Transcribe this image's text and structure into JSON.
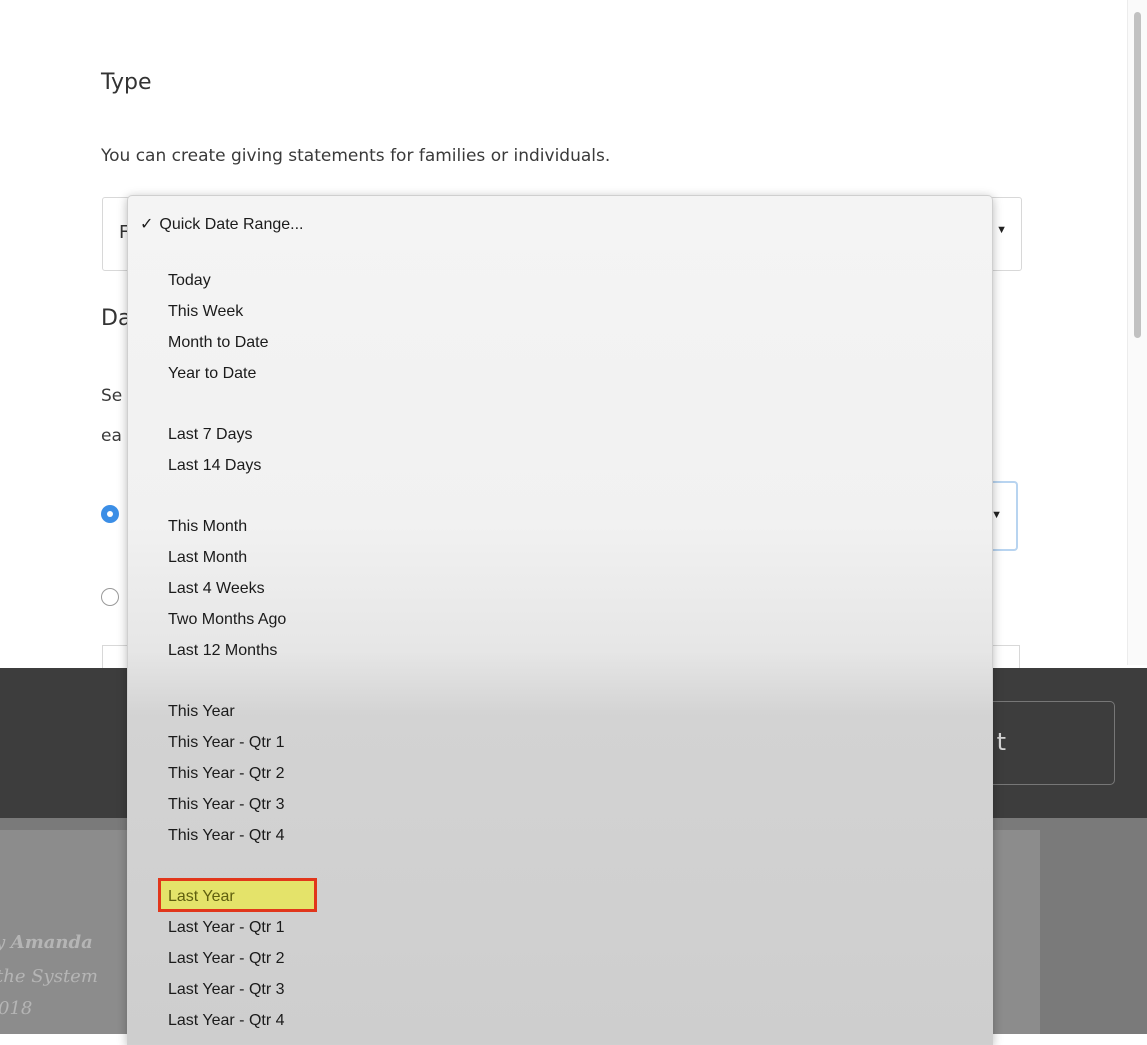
{
  "form": {
    "type_heading": "Type",
    "type_description": "You can create giving statements for families or individuals.",
    "type_select_partial": "F",
    "date_heading_partial": "Da",
    "date_desc_partial1": "Se",
    "date_desc_partial2": "ea"
  },
  "footer": {
    "button_partial": "t"
  },
  "footnotes": {
    "line1": "y Amanda",
    "line2": "the System",
    "line3": "018"
  },
  "dropdown": {
    "selected_label": "Quick Date Range...",
    "check_glyph": "✓",
    "highlighted_item": "Last Year",
    "groups": [
      [
        "Today",
        "This Week",
        "Month to Date",
        "Year to Date"
      ],
      [
        "Last 7 Days",
        "Last 14 Days"
      ],
      [
        "This Month",
        "Last Month",
        "Last 4 Weeks",
        "Two Months Ago",
        "Last 12 Months"
      ],
      [
        "This Year",
        "This Year - Qtr 1",
        "This Year - Qtr 2",
        "This Year - Qtr 3",
        "This Year - Qtr 4"
      ],
      [
        "Last Year",
        "Last Year - Qtr 1",
        "Last Year - Qtr 2",
        "Last Year - Qtr 3",
        "Last Year - Qtr 4"
      ]
    ]
  },
  "colors": {
    "radio_selected": "#3b8ee6",
    "highlight_fill": "#e4e36a",
    "highlight_border": "#e1361b",
    "footer_bar": "#3d3d3d"
  },
  "icons": {
    "select_caret": "caret-down-icon",
    "menu_check": "check-icon"
  }
}
